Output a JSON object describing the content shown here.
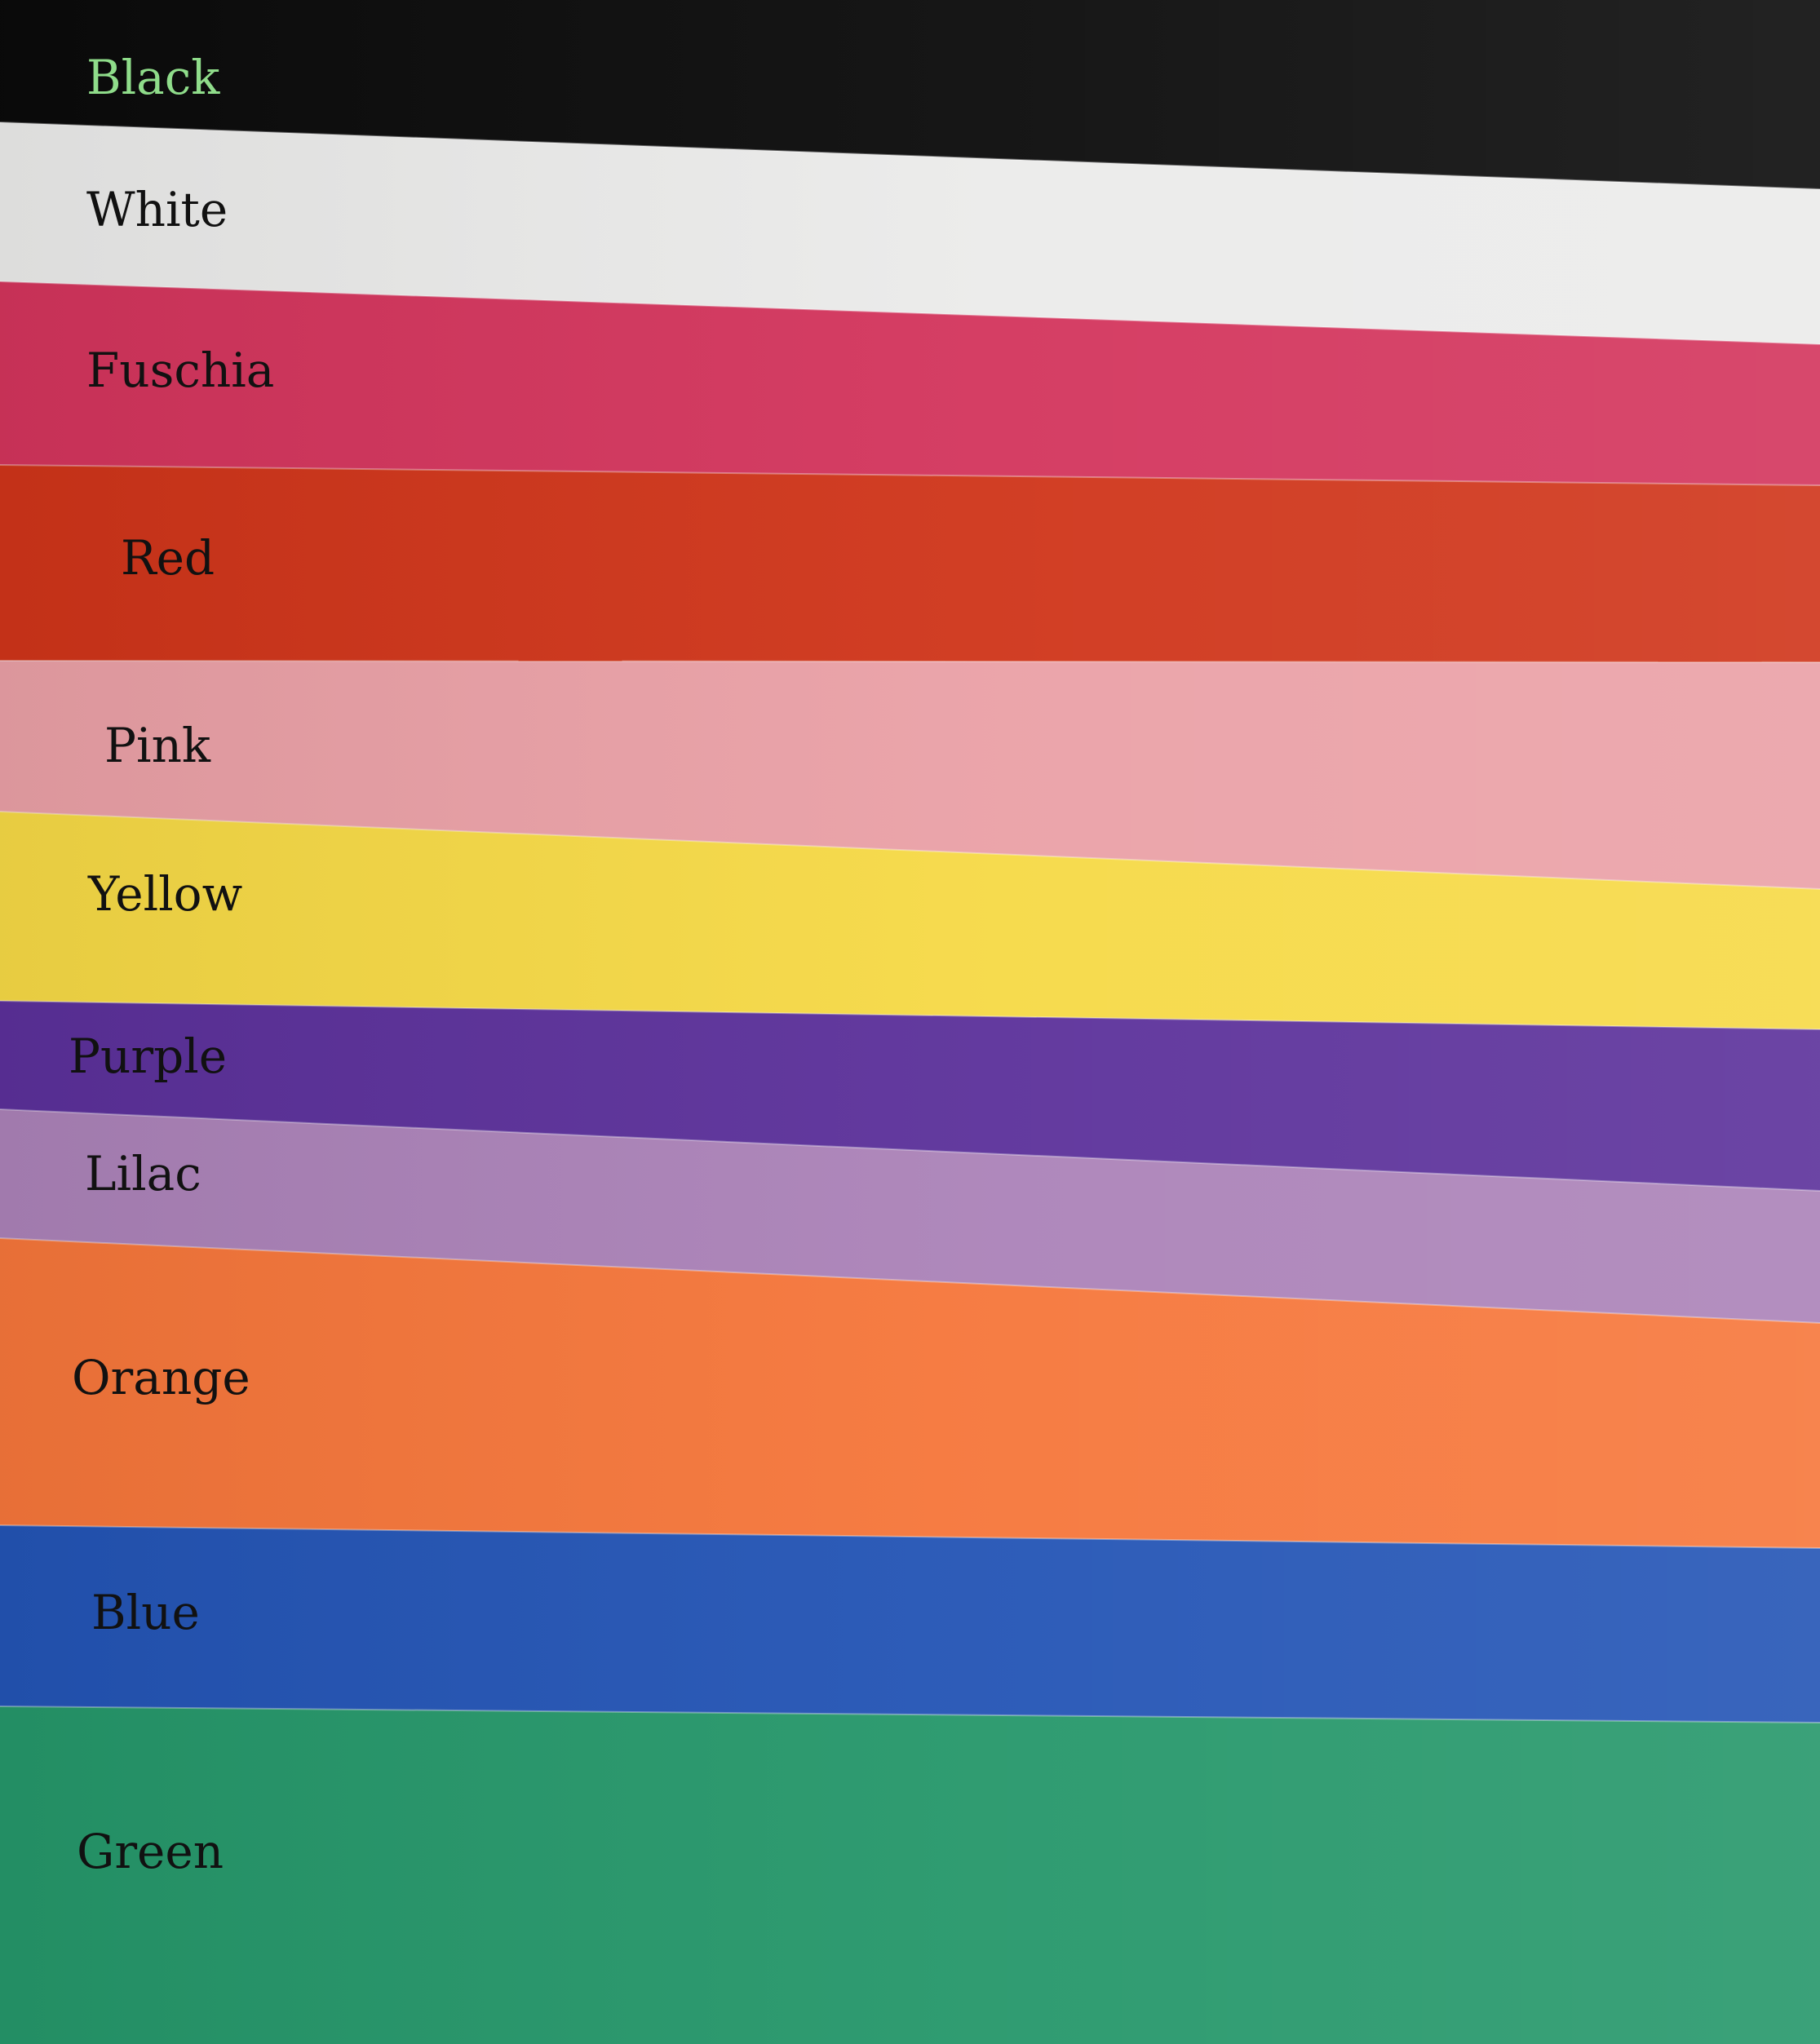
{
  "swatches": [
    {
      "name": "Black",
      "color": "#0a0a0a",
      "label_color": "#8fdc8a"
    },
    {
      "name": "White",
      "color": "#ebebea",
      "label_color": "#111111"
    },
    {
      "name": "Fuschia",
      "color": "#d3345c",
      "label_color": "#111111"
    },
    {
      "name": "Red",
      "color": "#cf3419",
      "label_color": "#111111"
    },
    {
      "name": "Pink",
      "color": "#eaa0a6",
      "label_color": "#111111"
    },
    {
      "name": "Yellow",
      "color": "#f6d945",
      "label_color": "#111111"
    },
    {
      "name": "Purple",
      "color": "#5b309a",
      "label_color": "#111111"
    },
    {
      "name": "Lilac",
      "color": "#ab82b8",
      "label_color": "#111111"
    },
    {
      "name": "Orange",
      "color": "#f6763a",
      "label_color": "#111111"
    },
    {
      "name": "Blue",
      "color": "#2354b5",
      "label_color": "#111111"
    },
    {
      "name": "Green",
      "color": "#25976a",
      "label_color": "#111111"
    }
  ]
}
